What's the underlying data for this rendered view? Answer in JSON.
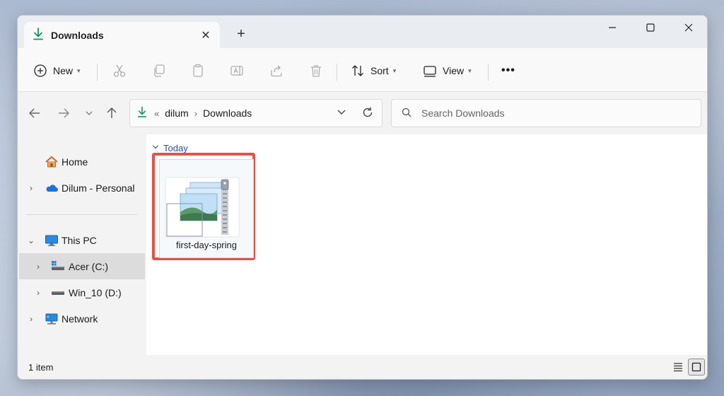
{
  "window": {
    "tab_title": "Downloads",
    "tab_close": "✕",
    "new_tab": "+",
    "minimize": "—",
    "maximize": "☐",
    "close": "✕"
  },
  "toolbar": {
    "new_label": "New",
    "sort_label": "Sort",
    "view_label": "View",
    "more": "•••"
  },
  "address": {
    "overflow": "«",
    "crumbs": [
      "dilum",
      "Downloads"
    ],
    "separator": "›"
  },
  "search": {
    "placeholder": "Search Downloads"
  },
  "sidebar": {
    "items": [
      {
        "label": "Home",
        "icon": "home-icon"
      },
      {
        "label": "Dilum - Personal",
        "icon": "onedrive-cloud-icon"
      },
      {
        "label": "This PC",
        "icon": "monitor-icon"
      },
      {
        "label": "Acer (C:)",
        "icon": "drive-icon"
      },
      {
        "label": "Win_10 (D:)",
        "icon": "drive-icon"
      },
      {
        "label": "Network",
        "icon": "network-icon"
      }
    ],
    "expand_collapsed": "›",
    "expand_open": "⌄"
  },
  "content": {
    "group_label": "Today",
    "files": [
      {
        "name": "first-day-spring",
        "icon": "zip-folder-icon"
      }
    ]
  },
  "status": {
    "item_count": "1 item"
  },
  "colors": {
    "accent": "#2a4d9c",
    "download_green": "#1a8f5a",
    "highlight_red": "#e0554a"
  }
}
